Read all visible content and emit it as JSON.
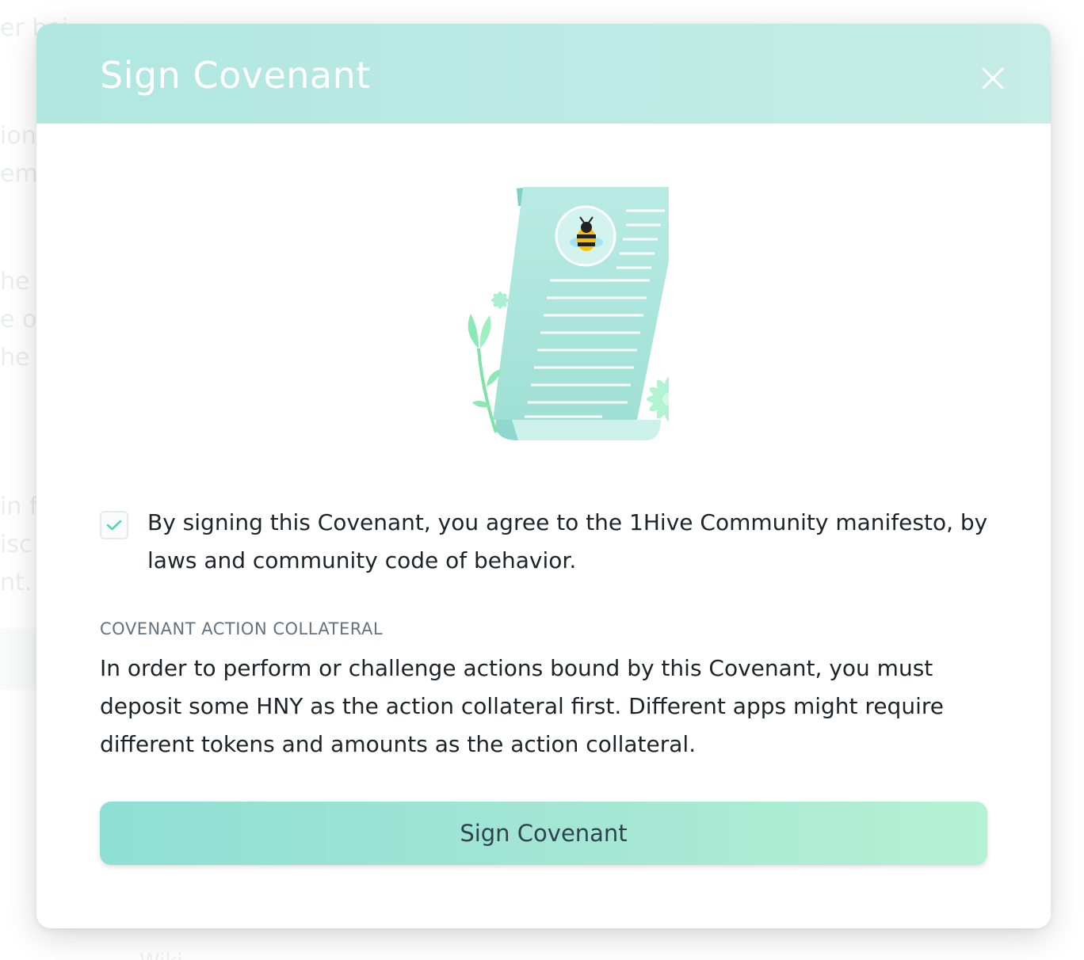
{
  "background": {
    "fragments": [
      "er bei",
      "ion",
      "em",
      "he p",
      "e ot",
      "he p",
      "in f",
      "isc",
      "nt."
    ],
    "footer_fragment": "Wiki"
  },
  "modal": {
    "title": "Sign Covenant",
    "close_icon": "close-icon",
    "illustration_icon": "covenant-scroll-bee-illustration",
    "agreement": {
      "checked": true,
      "text": "By signing this Covenant, you agree to the 1Hive Community manifesto, by laws and community code of behavior."
    },
    "collateral": {
      "label": "COVENANT ACTION COLLATERAL",
      "body": "In order to perform or challenge actions bound by this Covenant, you must deposit some HNY as the action collateral first. Different apps might require different tokens and amounts as the action collateral."
    },
    "primary_button": "Sign Covenant"
  },
  "colors": {
    "header_start": "#b0e7e1",
    "header_end": "#c6ede6",
    "button_start": "#8edfd4",
    "button_end": "#b5f1d4",
    "check_color": "#5ccfbf",
    "label_color": "#637381"
  }
}
